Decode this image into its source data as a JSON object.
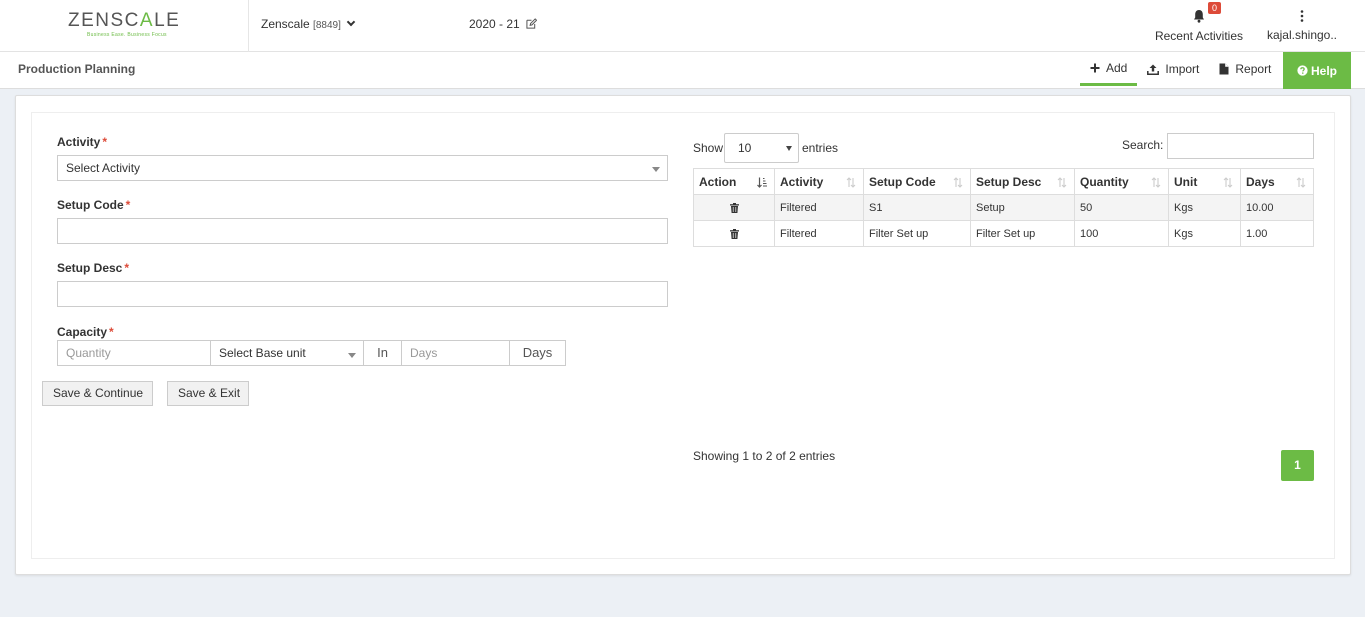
{
  "brand": {
    "name_left": "ZENSC",
    "name_mid": "A",
    "name_right": "LE",
    "tagline": "Business Ease. Business Focus"
  },
  "header": {
    "company": "Zenscale",
    "company_code": "[8849]",
    "fiscal_year": "2020 - 21",
    "notifications_count": "0",
    "recent_label": "Recent Activities",
    "user_label": "kajal.shingo.."
  },
  "subheader": {
    "title": "Production Planning",
    "add_label": "Add",
    "import_label": "Import",
    "report_label": "Report",
    "help_label": "Help"
  },
  "form": {
    "activity_label": "Activity",
    "activity_placeholder": "Select Activity",
    "setup_code_label": "Setup Code",
    "setup_code_value": "",
    "setup_desc_label": "Setup Desc",
    "setup_desc_value": "",
    "capacity_label": "Capacity",
    "quantity_placeholder": "Quantity",
    "base_unit_placeholder": "Select Base unit",
    "in_label": "In",
    "days_placeholder": "Days",
    "days_label": "Days",
    "required_mark": "*",
    "save_continue_label": "Save & Continue",
    "save_exit_label": "Save & Exit"
  },
  "table": {
    "show_label": "Show",
    "page_length": "10",
    "entries_label": "entries",
    "search_label": "Search:",
    "search_value": "",
    "columns": [
      "Action",
      "Activity",
      "Setup Code",
      "Setup Desc",
      "Quantity",
      "Unit",
      "Days"
    ],
    "rows": [
      {
        "activity": "Filtered",
        "setup_code": "S1",
        "setup_desc": "Setup",
        "quantity": "50",
        "unit": "Kgs",
        "days": "10.00"
      },
      {
        "activity": "Filtered",
        "setup_code": "Filter Set up",
        "setup_desc": "Filter Set up",
        "quantity": "100",
        "unit": "Kgs",
        "days": "1.00"
      }
    ],
    "info": "Showing 1 to 2 of 2 entries",
    "current_page": "1"
  },
  "colors": {
    "accent": "#6cbb45",
    "danger": "#dd4b39"
  }
}
